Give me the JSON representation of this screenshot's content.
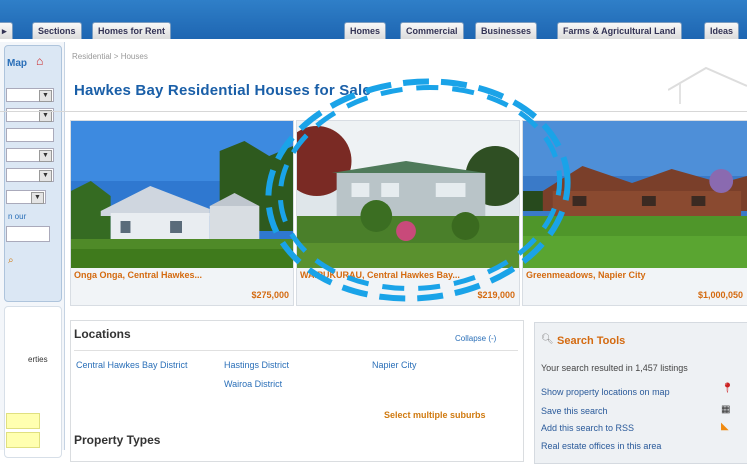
{
  "nav": {
    "left_tabs": [
      "Sections",
      "Homes for Rent"
    ],
    "right_tabs": [
      "Homes",
      "Commercial",
      "Businesses",
      "Farms & Agricultural Land",
      "Ideas"
    ]
  },
  "sidebar": {
    "map_label": "Map",
    "link_text": "n our",
    "bottom_text": "erties"
  },
  "breadcrumb": "Residential > Houses",
  "page_title": "Hawkes Bay Residential Houses for Sale",
  "listings": [
    {
      "location": "Onga Onga, Central Hawkes...",
      "price": "$275,000"
    },
    {
      "location": "WAIPUKURAU, Central Hawkes Bay...",
      "price": "$219,000"
    },
    {
      "location": "Greenmeadows, Napier City",
      "price": "$1,000,050"
    }
  ],
  "locations": {
    "heading": "Locations",
    "collapse": "Collapse (-)",
    "items": [
      "Central Hawkes Bay District",
      "Hastings District",
      "Napier City",
      "Wairoa District"
    ],
    "select_multiple": "Select multiple suburbs"
  },
  "property_types": {
    "heading": "Property Types"
  },
  "search_tools": {
    "heading": "Search Tools",
    "result_text": "Your search resulted in 1,457 listings",
    "show_map": "Show property locations on map",
    "save_search": "Save this search",
    "add_rss": "Add this search to RSS",
    "offices": "Real estate offices in this area"
  },
  "colors": {
    "nav_blue": "#1d64b0",
    "title_blue": "#1a5fa8",
    "accent_orange": "#d46a10",
    "annotation_cyan": "#1aa3e8"
  }
}
